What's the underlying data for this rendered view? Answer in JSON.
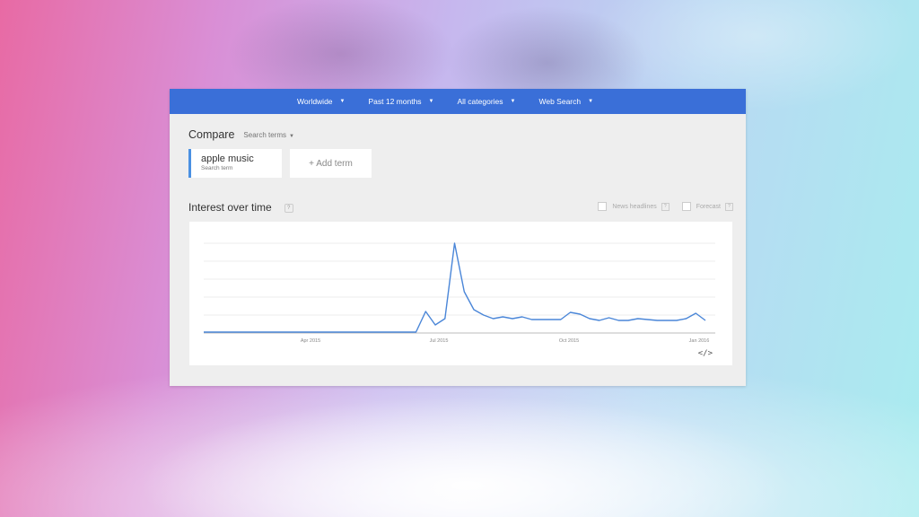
{
  "topbar": {
    "filters": [
      {
        "label": "Worldwide"
      },
      {
        "label": "Past 12 months"
      },
      {
        "label": "All categories"
      },
      {
        "label": "Web Search"
      }
    ]
  },
  "compare": {
    "title": "Compare",
    "search_terms_label": "Search terms",
    "term": {
      "name": "apple music",
      "subtitle": "Search term"
    },
    "add_term_label": "+ Add term"
  },
  "interest": {
    "title": "Interest over time",
    "help": "?",
    "options": [
      {
        "label": "News headlines"
      },
      {
        "label": "Forecast"
      }
    ]
  },
  "embed_label": "</>",
  "chart_data": {
    "type": "line",
    "x_ticks": [
      "Apr 2015",
      "Jul 2015",
      "Oct 2015",
      "Jan 2016"
    ],
    "ylim": [
      0,
      100
    ],
    "grid": true,
    "series": [
      {
        "color": "#4a86d8",
        "values": [
          1,
          1,
          1,
          1,
          1,
          1,
          1,
          1,
          1,
          1,
          1,
          1,
          1,
          1,
          1,
          1,
          1,
          1,
          1,
          1,
          1,
          1,
          1,
          24,
          9,
          16,
          100,
          46,
          26,
          20,
          16,
          18,
          16,
          18,
          15,
          15,
          15,
          15,
          23,
          21,
          16,
          14,
          17,
          14,
          14,
          16,
          15,
          14,
          14,
          14,
          16,
          22,
          14
        ]
      }
    ]
  }
}
